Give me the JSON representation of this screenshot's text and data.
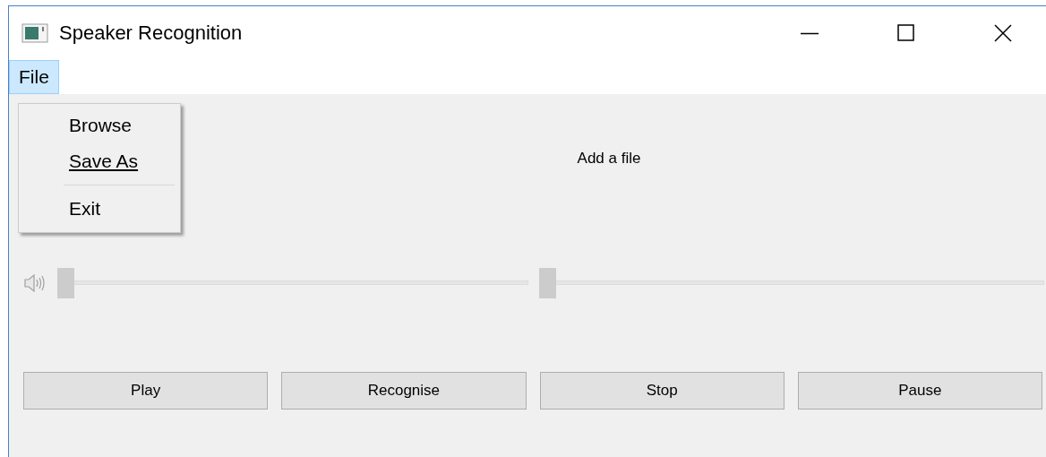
{
  "window": {
    "title": "Speaker Recognition"
  },
  "menu_bar": [
    {
      "label": "File",
      "selected": true
    }
  ],
  "file_menu": {
    "items": [
      {
        "kind": "item",
        "label": "Browse",
        "underlined": false
      },
      {
        "kind": "item",
        "label": "Save As",
        "underlined": true
      },
      {
        "kind": "separator"
      },
      {
        "kind": "item",
        "label": "Exit",
        "underlined": false
      }
    ]
  },
  "status_label": "Add a file",
  "sliders": [
    {
      "kind": "volume",
      "level": 0
    },
    {
      "kind": "position",
      "level": 0
    }
  ],
  "buttons": [
    "Play",
    "Recognise",
    "Stop",
    "Pause"
  ]
}
